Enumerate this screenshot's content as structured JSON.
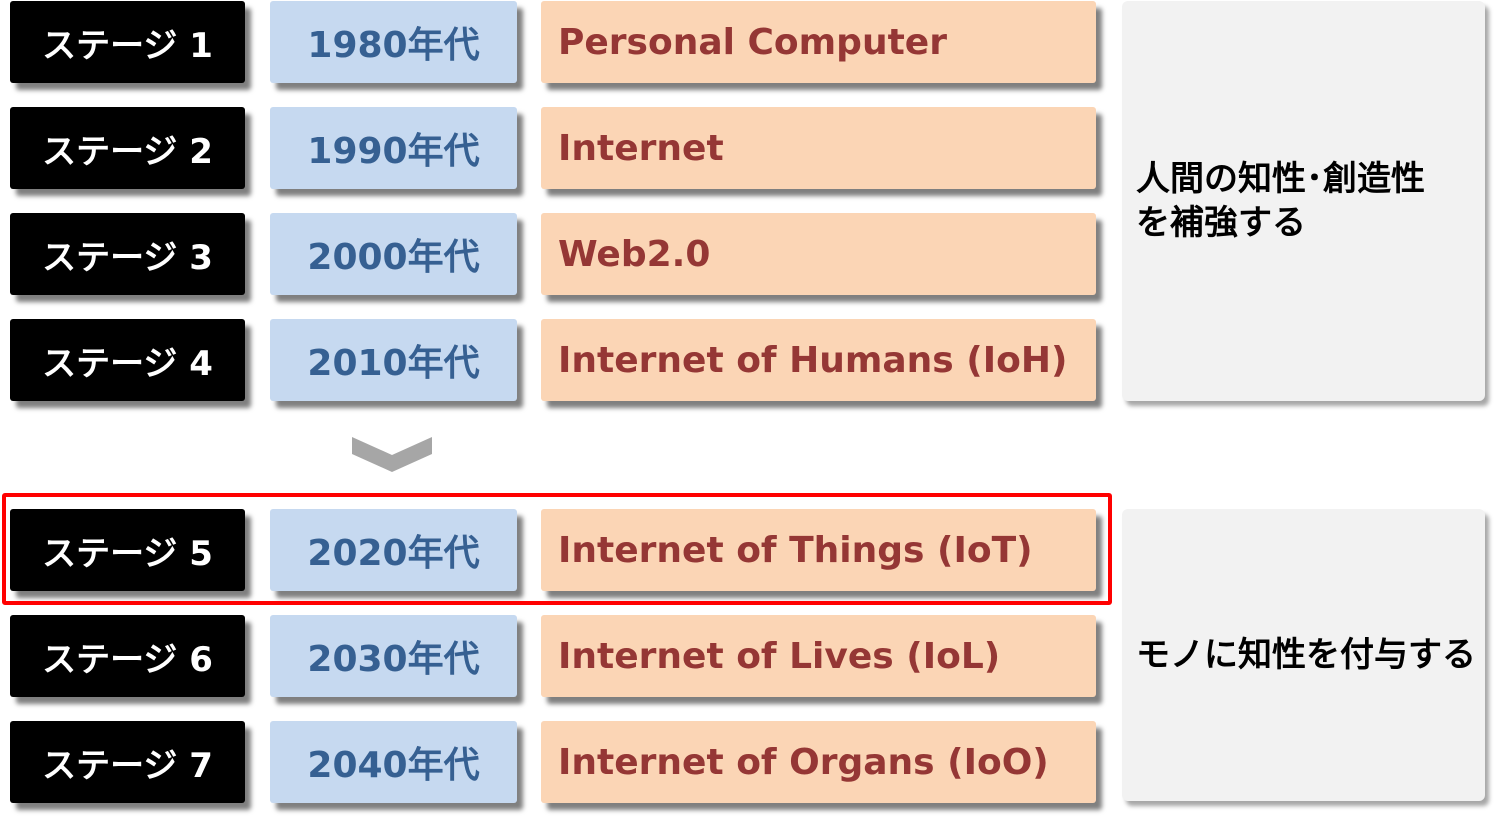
{
  "rows": [
    {
      "stage": "ステージ 1",
      "decade": "1980年代",
      "name": "Personal Computer"
    },
    {
      "stage": "ステージ 2",
      "decade": "1990年代",
      "name": "Internet"
    },
    {
      "stage": "ステージ 3",
      "decade": "2000年代",
      "name": "Web2.0"
    },
    {
      "stage": "ステージ 4",
      "decade": "2010年代",
      "name": "Internet of Humans (IoH)"
    },
    {
      "stage": "ステージ 5",
      "decade": "2020年代",
      "name": "Internet of Things (IoT)"
    },
    {
      "stage": "ステージ 6",
      "decade": "2030年代",
      "name": "Internet of Lives (IoL)"
    },
    {
      "stage": "ステージ 7",
      "decade": "2040年代",
      "name": "Internet of Organs (IoO)"
    }
  ],
  "groups": {
    "first": {
      "line1": "人間の知性･創造性",
      "line2": "を補強する"
    },
    "second": {
      "text": "モノに知性を付与する"
    }
  },
  "highlight": {
    "row": "ステージ 5",
    "color": "#ff0000"
  },
  "colors": {
    "stage_bg": "#000000",
    "decade_bg": "#c6d9f0",
    "decade_text": "#366092",
    "name_bg": "#fbd5b5",
    "name_text": "#953735",
    "group_bg": "#f2f2f2",
    "arrow": "#a6a6a6"
  },
  "arrow_icon": "chevron-down-icon"
}
